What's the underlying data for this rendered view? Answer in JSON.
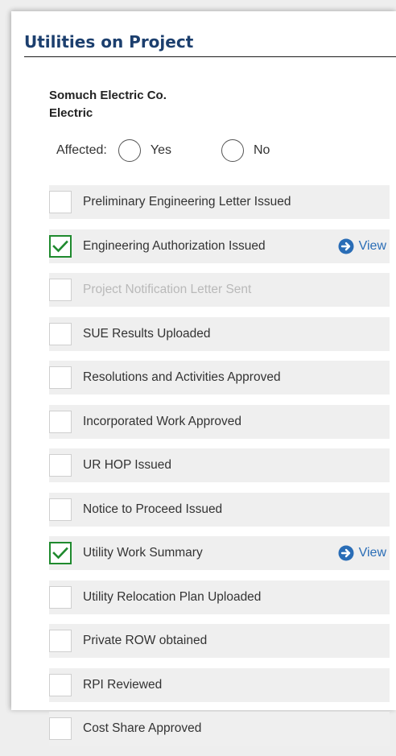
{
  "header": {
    "title": "Utilities on Project"
  },
  "utility": {
    "company": "Somuch Electric Co.",
    "type": "Electric",
    "affected_label": "Affected:",
    "options": [
      "Yes",
      "No"
    ]
  },
  "view_label": "View",
  "colors": {
    "title": "#1c3f6e",
    "check": "#1f8a2e",
    "link": "#2a6db6"
  },
  "items": [
    {
      "label": "Preliminary Engineering Letter Issued",
      "checked": false,
      "disabled": false,
      "view": false
    },
    {
      "label": "Engineering Authorization Issued",
      "checked": true,
      "disabled": false,
      "view": true
    },
    {
      "label": "Project Notification Letter Sent",
      "checked": false,
      "disabled": true,
      "view": false
    },
    {
      "label": "SUE Results Uploaded",
      "checked": false,
      "disabled": false,
      "view": false
    },
    {
      "label": "Resolutions and Activities Approved",
      "checked": false,
      "disabled": false,
      "view": false
    },
    {
      "label": "Incorporated Work Approved",
      "checked": false,
      "disabled": false,
      "view": false
    },
    {
      "label": "UR HOP Issued",
      "checked": false,
      "disabled": false,
      "view": false
    },
    {
      "label": "Notice to Proceed Issued",
      "checked": false,
      "disabled": false,
      "view": false
    },
    {
      "label": "Utility Work Summary",
      "checked": true,
      "disabled": false,
      "view": true
    },
    {
      "label": "Utility Relocation Plan Uploaded",
      "checked": false,
      "disabled": false,
      "view": false
    },
    {
      "label": "Private ROW obtained",
      "checked": false,
      "disabled": false,
      "view": false
    },
    {
      "label": "RPI Reviewed",
      "checked": false,
      "disabled": false,
      "view": false
    },
    {
      "label": "Cost Share Approved",
      "checked": false,
      "disabled": false,
      "view": false
    }
  ]
}
